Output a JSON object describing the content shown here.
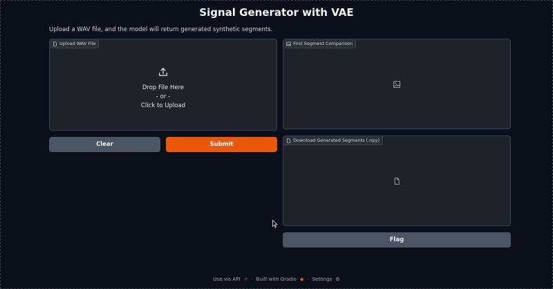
{
  "app": {
    "title": "Signal Generator with VAE",
    "description": "Upload a WAV file, and the model will return generated synthetic segments."
  },
  "upload": {
    "label": "Upload WAV File",
    "drop_text": "Drop File Here",
    "or_text": "- or -",
    "click_text": "Click to Upload",
    "icon": "upload-icon"
  },
  "comparison": {
    "label": "First Segment Comparison",
    "icon": "image-icon"
  },
  "download": {
    "label": "Download Generated Segments (.npy)",
    "icon": "file-icon"
  },
  "buttons": {
    "clear": "Clear",
    "submit": "Submit",
    "flag": "Flag"
  },
  "footer": {
    "api": "Use via API",
    "built": "Built with Gradio",
    "settings": "Settings",
    "sep": "·"
  },
  "colors": {
    "background": "#0b0f19",
    "panel": "#1f2329",
    "primary": "#ea580c",
    "secondary": "#4b5563"
  }
}
